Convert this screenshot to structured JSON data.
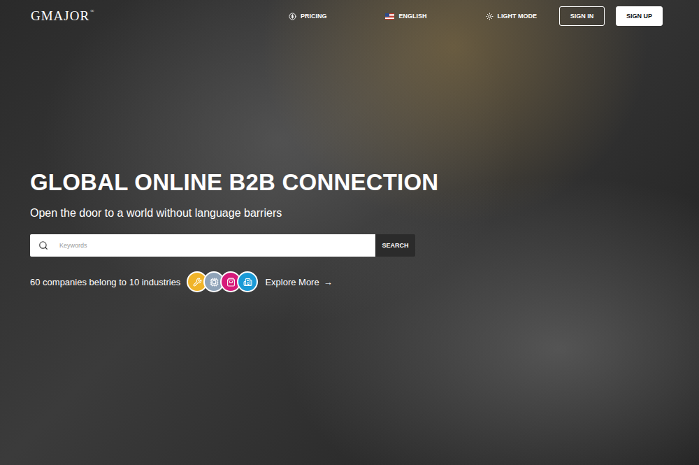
{
  "logo": {
    "text": "GMAJOR",
    "mark": "®"
  },
  "nav": {
    "pricing": "PRICING",
    "language": "ENGLISH",
    "mode": "LIGHT MODE"
  },
  "auth": {
    "sign_in": "SIGN IN",
    "sign_up": "SIGN UP"
  },
  "hero": {
    "title": "GLOBAL ONLINE B2B CONNECTION",
    "subtitle": "Open the door to a world without language barriers"
  },
  "search": {
    "placeholder": "Keywords",
    "button": "SEARCH"
  },
  "stats": {
    "text": "60 companies belong to 10 industries",
    "explore": "Explore More",
    "arrow": "→"
  },
  "industries": [
    {
      "color": "#f0b429"
    },
    {
      "color": "#8fa3b8"
    },
    {
      "color": "#d6197a"
    },
    {
      "color": "#1a9ad6"
    }
  ]
}
